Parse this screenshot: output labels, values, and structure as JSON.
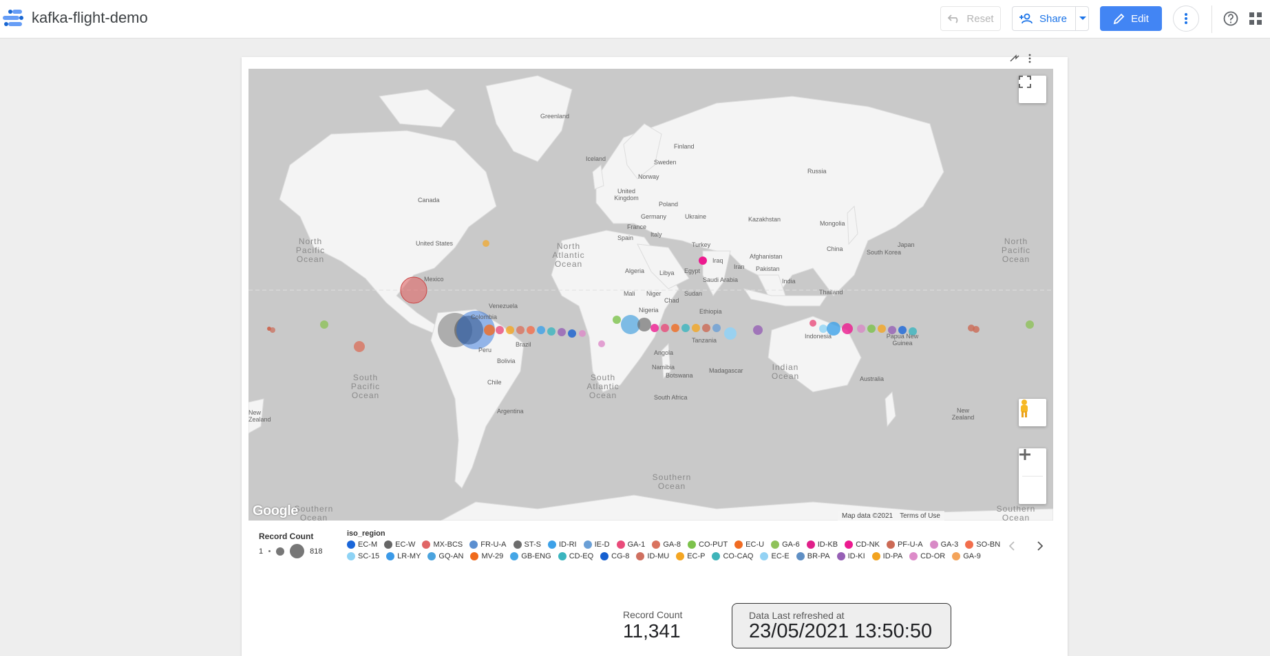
{
  "header": {
    "title": "kafka-flight-demo",
    "reset_label": "Reset",
    "share_label": "Share",
    "edit_label": "Edit",
    "accent": "#4285f4"
  },
  "map": {
    "countries": [
      "Greenland",
      "Iceland",
      "Finland",
      "Sweden",
      "Norway",
      "Russia",
      "United Kingdom",
      "Poland",
      "Germany",
      "Ukraine",
      "France",
      "Kazakhstan",
      "Mongolia",
      "Spain",
      "Italy",
      "Turkey",
      "Japan",
      "Canada",
      "United States",
      "China",
      "South Korea",
      "Afghanistan",
      "Iraq",
      "Iran",
      "Algeria",
      "Libya",
      "Egypt",
      "Pakistan",
      "Saudi Arabia",
      "India",
      "Thailand",
      "Mexico",
      "Mali",
      "Niger",
      "Chad",
      "Sudan",
      "Venezuela",
      "Colombia",
      "Nigeria",
      "Ethiopia",
      "Indonesia",
      "Papua New Guinea",
      "Brazil",
      "Peru",
      "Tanzania",
      "Angola",
      "Bolivia",
      "Namibia",
      "Botswana",
      "Madagascar",
      "Australia",
      "Chile",
      "South Africa",
      "Argentina",
      "New Zealand",
      "New Zealand"
    ],
    "oceans": [
      "North Pacific Ocean",
      "North Atlantic Ocean",
      "North Pacific Ocean",
      "South Pacific Ocean",
      "South Atlantic Ocean",
      "Indian Ocean",
      "Southern Ocean",
      "Southern Ocean",
      "Southern Ocean"
    ],
    "google_text": "Google",
    "attribution": "Map data ©2021",
    "terms": "Terms of Use"
  },
  "legend": {
    "size_title": "Record Count",
    "size_min": "1",
    "size_max": "818",
    "color_title": "iso_region",
    "row1": [
      {
        "label": "EC-M",
        "color": "#1a66d9"
      },
      {
        "label": "EC-W",
        "color": "#666666"
      },
      {
        "label": "MX-BCS",
        "color": "#e06666"
      },
      {
        "label": "FR-U-A",
        "color": "#5b8fd0"
      },
      {
        "label": "ST-S",
        "color": "#6d6d6d"
      },
      {
        "label": "ID-RI",
        "color": "#3da1e8"
      },
      {
        "label": "IE-D",
        "color": "#6a9fd6"
      },
      {
        "label": "GA-1",
        "color": "#e94b7a"
      },
      {
        "label": "GA-8",
        "color": "#d9735f"
      },
      {
        "label": "CO-PUT",
        "color": "#7cc24b"
      },
      {
        "label": "EC-U",
        "color": "#f06b22"
      },
      {
        "label": "GA-6",
        "color": "#8fc25a"
      },
      {
        "label": "ID-KB",
        "color": "#e0208a"
      },
      {
        "label": "CD-NK",
        "color": "#ec1a8f"
      },
      {
        "label": "PF-U-A",
        "color": "#cc6a55"
      },
      {
        "label": "GA-3",
        "color": "#d88ac6"
      },
      {
        "label": "SO-BN",
        "color": "#f26e4c"
      }
    ],
    "row2": [
      {
        "label": "SC-15",
        "color": "#8ed3f5"
      },
      {
        "label": "LR-MY",
        "color": "#3b9ae8"
      },
      {
        "label": "GQ-AN",
        "color": "#4aa3de"
      },
      {
        "label": "MV-29",
        "color": "#ef6a1c"
      },
      {
        "label": "GB-ENG",
        "color": "#44a6e6"
      },
      {
        "label": "CD-EQ",
        "color": "#3bb5bf"
      },
      {
        "label": "CG-8",
        "color": "#1560d0"
      },
      {
        "label": "ID-MU",
        "color": "#cf7060"
      },
      {
        "label": "EC-P",
        "color": "#f4a623"
      },
      {
        "label": "CO-CAQ",
        "color": "#3fb4b9"
      },
      {
        "label": "EC-E",
        "color": "#93d2f4"
      },
      {
        "label": "BR-PA",
        "color": "#5f8fc4"
      },
      {
        "label": "ID-KI",
        "color": "#9660b5"
      },
      {
        "label": "ID-PA",
        "color": "#f2a31f"
      },
      {
        "label": "CD-OR",
        "color": "#dd8bc9"
      },
      {
        "label": "GA-9",
        "color": "#f4a45a"
      }
    ]
  },
  "scorecard": {
    "label": "Record Count",
    "value": "11,341"
  },
  "refresh": {
    "label": "Data Last refreshed at",
    "value": "23/05/2021 13:50:50"
  }
}
